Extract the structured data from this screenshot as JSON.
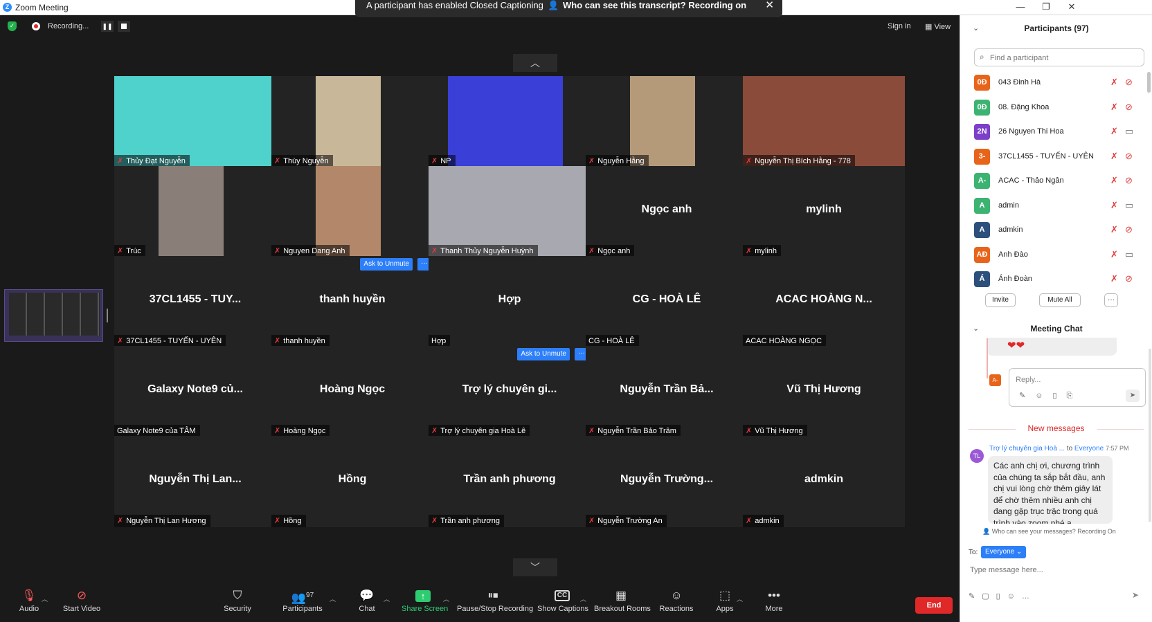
{
  "window": {
    "title": "Zoom Meeting",
    "min": "—",
    "max": "❐",
    "close": "✕"
  },
  "banner": {
    "text1": "A participant has enabled Closed Captioning",
    "text2": "Who can see this transcript? Recording on",
    "close": "✕"
  },
  "topbar": {
    "recording": "Recording...",
    "sign_in": "Sign in",
    "view": "View"
  },
  "tiles": [
    {
      "label": "Thủy Đạt Nguyễn",
      "muted": true,
      "video": true,
      "bg": "#4fd1cc"
    },
    {
      "label": "Thùy Nguyễn",
      "muted": true,
      "video": true,
      "bg": "#c9b79a"
    },
    {
      "label": "NP",
      "muted": true,
      "video": true,
      "bg": "#3a3fd8"
    },
    {
      "label": "Nguyễn Hằng",
      "muted": true,
      "video": true,
      "bg": "#b59a7a"
    },
    {
      "label": "Nguyễn Thị Bích Hằng - 778",
      "muted": true,
      "video": true,
      "bg": "#8b4b3a"
    },
    {
      "label": "Trúc",
      "muted": true,
      "video": true,
      "bg": "#8a7f78"
    },
    {
      "label": "Nguyen Dang Anh",
      "muted": true,
      "video": true,
      "bg": "#b3886a"
    },
    {
      "label": "Thanh Thủy Nguyễn Huỳnh",
      "muted": true,
      "video": true,
      "bg": "#a8a8b0"
    },
    {
      "center": "Ngọc anh",
      "label": "Ngọc anh",
      "muted": true
    },
    {
      "center": "mylinh",
      "label": "mylinh",
      "muted": true
    },
    {
      "center": "37CL1455 - TUY...",
      "label": "37CL1455 - TUYẾN - UYÊN",
      "muted": true
    },
    {
      "center": "thanh huyền",
      "label": "thanh huyền",
      "muted": true,
      "ask": true
    },
    {
      "center": "Hợp",
      "label": "Hợp",
      "muted": false
    },
    {
      "center": "CG - HOÀ LÊ",
      "label": "CG - HOÀ LÊ",
      "muted": false
    },
    {
      "center": "ACAC HOÀNG N...",
      "label": "ACAC HOÀNG NGỌC",
      "muted": false
    },
    {
      "center": "Galaxy Note9 củ...",
      "label": "Galaxy Note9 của TÂM",
      "muted": false
    },
    {
      "center": "Hoàng Ngọc",
      "label": "Hoàng Ngọc",
      "muted": true
    },
    {
      "center": "Trợ lý chuyên gi...",
      "label": "Trợ lý chuyên gia Hoà Lê",
      "muted": true,
      "ask": true
    },
    {
      "center": "Nguyễn Trần Bả...",
      "label": "Nguyễn Trần Bảo Trâm",
      "muted": true
    },
    {
      "center": "Vũ Thị Hương",
      "label": "Vũ Thị Hương",
      "muted": true
    },
    {
      "center": "Nguyễn Thị Lan...",
      "label": "Nguyễn Thị Lan Hương",
      "muted": true
    },
    {
      "center": "Hồng",
      "label": "Hồng",
      "muted": true
    },
    {
      "center": "Trần anh phương",
      "label": "Trần anh phương",
      "muted": true
    },
    {
      "center": "Nguyễn Trường...",
      "label": "Nguyễn Trường An",
      "muted": true
    },
    {
      "center": "admkin",
      "label": "admkin",
      "muted": true
    }
  ],
  "ask_to_unmute": "Ask to Unmute",
  "ask_more": "···",
  "toolbar": {
    "audio": "Audio",
    "start_video": "Start Video",
    "security": "Security",
    "participants": "Participants",
    "participants_count": "97",
    "chat": "Chat",
    "share_screen": "Share Screen",
    "pause_stop": "Pause/Stop Recording",
    "captions": "Show Captions",
    "breakout": "Breakout Rooms",
    "reactions": "Reactions",
    "apps": "Apps",
    "more": "More",
    "end": "End"
  },
  "participants_panel": {
    "title": "Participants (97)",
    "search_placeholder": "Find a participant",
    "invite": "Invite",
    "mute_all": "Mute All",
    "more": "···",
    "list": [
      {
        "initials": "0Đ",
        "name": "043 Đinh Hà",
        "color": "#e8641a",
        "video": false
      },
      {
        "initials": "0Đ",
        "name": "08. Đặng Khoa",
        "color": "#3cb371",
        "video": false
      },
      {
        "initials": "2N",
        "name": "26 Nguyen Thi Hoa",
        "color": "#7b3fc9",
        "video": true
      },
      {
        "initials": "3-",
        "name": "37CL1455 - TUYẾN - UYÊN",
        "color": "#e8641a",
        "video": false
      },
      {
        "initials": "A-",
        "name": "ACAC - Thảo Ngân",
        "color": "#3cb371",
        "video": false
      },
      {
        "initials": "A",
        "name": "admin",
        "color": "#3cb371",
        "video": true
      },
      {
        "initials": "A",
        "name": "admkin",
        "color": "#2c4f7c",
        "video": false
      },
      {
        "initials": "AĐ",
        "name": "Anh Đào",
        "color": "#e8641a",
        "video": true
      },
      {
        "initials": "Á",
        "name": "Ánh Đoàn",
        "color": "#2c4f7c",
        "video": false
      }
    ]
  },
  "chat_panel": {
    "title": "Meeting Chat",
    "reaction": "❤❤",
    "reply_placeholder": "Reply...",
    "reply_avatar": "A-",
    "new_messages": "New messages",
    "msg_sender": "Trợ lý chuyên gia Hoà ...",
    "msg_to_prefix": "to",
    "msg_to": "Everyone",
    "msg_time": "7:57 PM",
    "msg_avatar": "TL",
    "msg_text": "Các anh chị ơi, chương trình của chúng ta sắp bắt đầu, anh chị vui lòng chờ thêm giây lát để chờ thêm nhiều anh chị đang gặp trục trặc trong quá trình vào zoom nhé ạ.",
    "who_can_see": "Who can see your messages? Recording On",
    "to_label": "To:",
    "to_value": "Everyone ⌄",
    "input_placeholder": "Type message here..."
  }
}
